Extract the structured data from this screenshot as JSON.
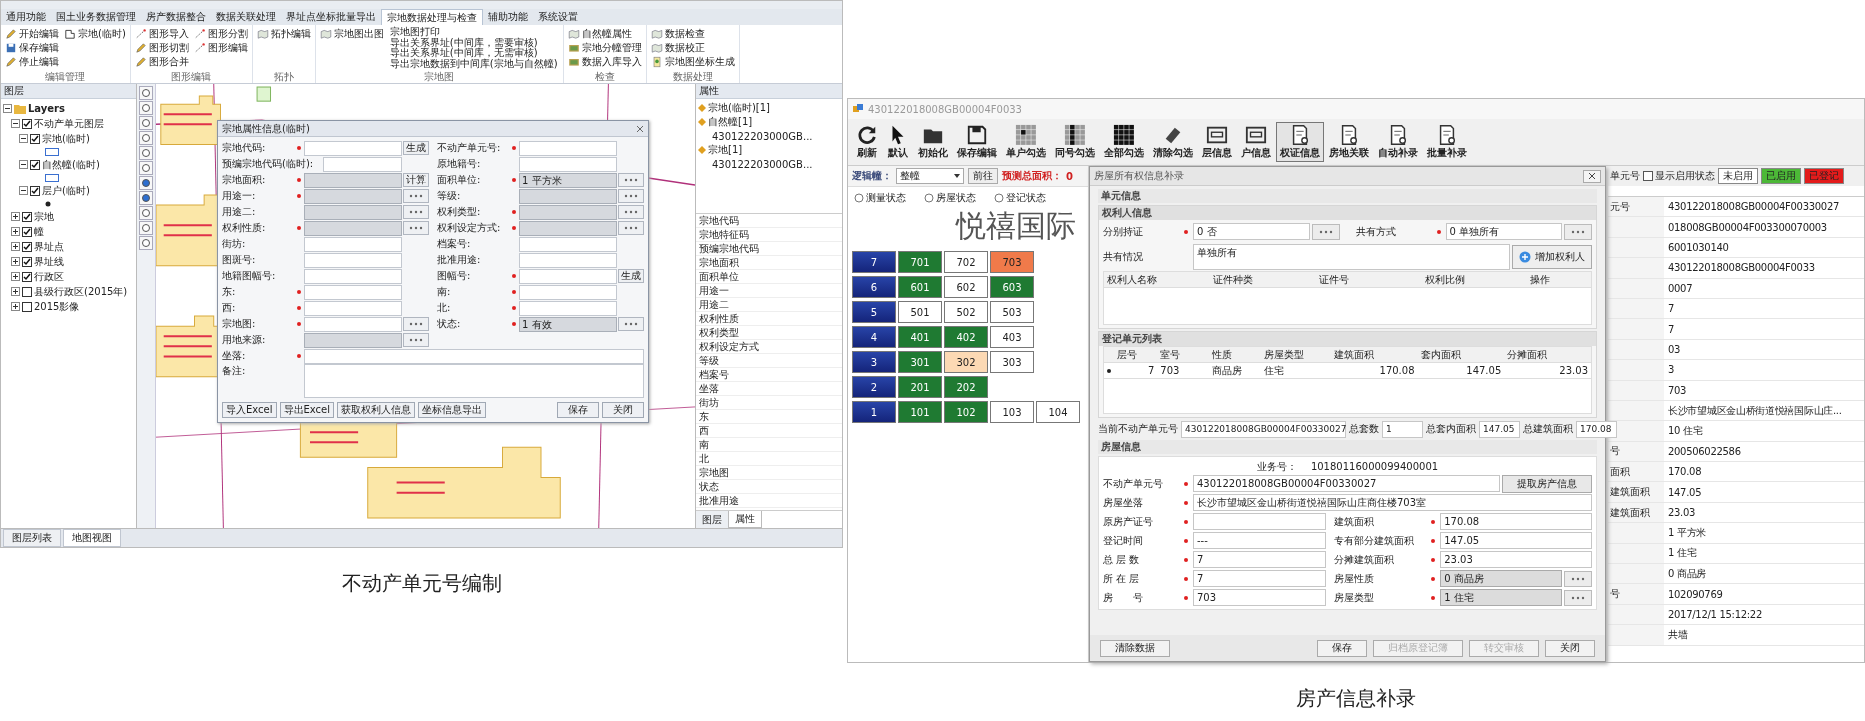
{
  "left_figure": {
    "caption": "不动产单元号编制",
    "ribbon": {
      "tabs": [
        {
          "label": "通用功能",
          "selected": false
        },
        {
          "label": "国土业务数据管理",
          "selected": false
        },
        {
          "label": "房产数据整合",
          "selected": false
        },
        {
          "label": "数据关联处理",
          "selected": false
        },
        {
          "label": "界址点坐标批量导出",
          "selected": false
        },
        {
          "label": "宗地数据处理与检查",
          "selected": true
        },
        {
          "label": "辅助功能",
          "selected": false
        },
        {
          "label": "系统设置",
          "selected": false
        }
      ],
      "groups": [
        {
          "name": "编辑管理",
          "items": [
            "开始编辑",
            "保存编辑",
            "停止编辑",
            "宗地(临时)"
          ]
        },
        {
          "name": "图形编辑",
          "items": [
            "图形导入",
            "图形切割",
            "图形合并",
            "图形分割",
            "图形编辑"
          ]
        },
        {
          "name": "拓扑",
          "items": [
            "拓扑编辑"
          ]
        },
        {
          "name": "宗地图",
          "items": [
            "宗地图出图"
          ],
          "links": [
            "宗地图打印",
            "导出关系界址(中间库，需要审核)",
            "导出关系界址(中间库，无需审核)",
            "导出宗地数据到中间库(宗地与自然幢)"
          ]
        },
        {
          "name": "检查",
          "items": [
            "自然幢属性",
            "宗地分幢管理",
            "数据入库导入"
          ]
        },
        {
          "name": "数据处理",
          "items": [
            "数据检查",
            "数据校正",
            "宗地图坐标生成"
          ]
        }
      ]
    },
    "layer_panel": {
      "title": "图层",
      "tree": [
        {
          "label": "Layers",
          "expanded": true,
          "children": [
            {
              "label": "不动产单元图层",
              "checked": true,
              "expanded": true,
              "children": [
                {
                  "label": "宗地(临时)",
                  "checked": true,
                  "expanded": true,
                  "kind": "polygon"
                },
                {
                  "label": "自然幢(临时)",
                  "checked": true,
                  "expanded": true,
                  "kind": "polygon"
                },
                {
                  "label": "层户(临时)",
                  "checked": true,
                  "expanded": true,
                  "kind": "point"
                }
              ]
            },
            {
              "label": "宗地",
              "checked": true,
              "expanded": false
            },
            {
              "label": "幢",
              "checked": true,
              "expanded": false
            },
            {
              "label": "界址点",
              "checked": true,
              "expanded": false
            },
            {
              "label": "界址线",
              "checked": true,
              "expanded": false
            },
            {
              "label": "行政区",
              "checked": true,
              "expanded": false
            },
            {
              "label": "县级行政区(2015年)",
              "checked": false,
              "expanded": false
            },
            {
              "label": "2015影像",
              "checked": false,
              "expanded": false
            }
          ]
        }
      ]
    },
    "dialog": {
      "title": "宗地属性信息(临时)",
      "left_fields": [
        {
          "label": "宗地代码:",
          "required": true,
          "disabled": false,
          "action": "生成"
        },
        {
          "label": "预编宗地代码(临时):",
          "required": false,
          "disabled": false
        },
        {
          "label": "宗地面积:",
          "required": true,
          "disabled": true,
          "action": "计算"
        },
        {
          "label": "用途一:",
          "required": true,
          "disabled": true,
          "picker": true
        },
        {
          "label": "用途二:",
          "required": false,
          "disabled": true,
          "picker": true
        },
        {
          "label": "权利性质:",
          "required": true,
          "disabled": true,
          "picker": true
        },
        {
          "label": "街坊:",
          "required": false,
          "disabled": false
        },
        {
          "label": "图斑号:",
          "required": false,
          "disabled": false
        },
        {
          "label": "地籍图幅号:",
          "required": false,
          "disabled": false
        },
        {
          "label": "东:",
          "required": true,
          "disabled": false
        },
        {
          "label": "西:",
          "required": true,
          "disabled": false
        },
        {
          "label": "宗地图:",
          "required": true,
          "disabled": false,
          "picker": true
        },
        {
          "label": "用地来源:",
          "required": false,
          "disabled": true,
          "picker": true
        }
      ],
      "right_fields": [
        {
          "label": "不动产单元号:",
          "required": true,
          "disabled": false
        },
        {
          "label": "原地籍号:",
          "required": false,
          "disabled": false
        },
        {
          "label": "面积单位:",
          "required": true,
          "disabled": true,
          "value": "1 平方米",
          "picker": true
        },
        {
          "label": "等级:",
          "required": false,
          "disabled": true,
          "picker": true
        },
        {
          "label": "权利类型:",
          "required": true,
          "disabled": true,
          "picker": true
        },
        {
          "label": "权利设定方式:",
          "required": true,
          "disabled": true,
          "picker": true
        },
        {
          "label": "档案号:",
          "required": false,
          "disabled": false
        },
        {
          "label": "批准用途:",
          "required": false,
          "disabled": false
        },
        {
          "label": "图幅号:",
          "required": true,
          "disabled": false,
          "action": "生成"
        },
        {
          "label": "南:",
          "required": true,
          "disabled": false
        },
        {
          "label": "北:",
          "required": true,
          "disabled": false
        },
        {
          "label": "状态:",
          "required": true,
          "disabled": true,
          "value": "1 有效",
          "picker": true
        }
      ],
      "address": {
        "label": "坐落:",
        "required": true
      },
      "remarks": {
        "label": "备注:"
      },
      "left_buttons": [
        "导入Excel",
        "导出Excel",
        "获取权利人信息",
        "坐标信息导出"
      ],
      "right_buttons": [
        "保存",
        "关闭"
      ]
    },
    "attribute_panel": {
      "title": "属性",
      "tree": [
        {
          "label": "宗地(临时)[1]"
        },
        {
          "label": "自然幢[1]",
          "children": [
            "430122203000GB..."
          ]
        },
        {
          "label": "宗地[1]",
          "children": [
            "430122203000GB..."
          ]
        }
      ],
      "properties": [
        "宗地代码",
        "宗地特征码",
        "预编宗地代码",
        "宗地面积",
        "面积单位",
        "用途一",
        "用途二",
        "权利性质",
        "权利类型",
        "权利设定方式",
        "等级",
        "档案号",
        "坐落",
        "街坊",
        "东",
        "西",
        "南",
        "北",
        "宗地图",
        "状态",
        "批准用途"
      ],
      "tabs": [
        {
          "label": "图层",
          "selected": false
        },
        {
          "label": "属性",
          "selected": true
        }
      ]
    },
    "bottom_tabs": [
      {
        "label": "图层列表",
        "selected": false
      },
      {
        "label": "地图视图",
        "selected": true
      }
    ]
  },
  "right_figure": {
    "caption": "房产信息补录",
    "title": "430122018008GB00004F0033",
    "toolbar": [
      {
        "label": "刷新",
        "selected": false
      },
      {
        "label": "默认",
        "selected": false
      },
      {
        "label": "初始化",
        "selected": false
      },
      {
        "label": "保存编辑",
        "selected": false
      },
      {
        "label": "单户勾选",
        "selected": false
      },
      {
        "label": "同号勾选",
        "selected": false
      },
      {
        "label": "全部勾选",
        "selected": false
      },
      {
        "label": "清除勾选",
        "selected": false
      },
      {
        "label": "层信息",
        "selected": false
      },
      {
        "label": "户信息",
        "selected": false
      },
      {
        "label": "权证信息",
        "selected": true
      },
      {
        "label": "房地关联",
        "selected": false
      },
      {
        "label": "自动补录",
        "selected": false
      },
      {
        "label": "批量补录",
        "selected": false
      }
    ],
    "building": {
      "selector_label": "逻辑幢：",
      "selector_value": "整幢",
      "go_button": "前往",
      "area_label": "预测总面积：",
      "area_value": "0",
      "modes": [
        {
          "label": "测量状态",
          "selected": false
        },
        {
          "label": "房屋状态",
          "selected": false
        },
        {
          "label": "登记状态",
          "selected": false
        }
      ],
      "name": "悦禧国际",
      "floors": [
        {
          "floor": "7",
          "units": [
            {
              "label": "701",
              "color": "#1f7a32"
            },
            {
              "label": "702",
              "color": "#ffffff"
            },
            {
              "label": "703",
              "color": "#f07a4a"
            }
          ]
        },
        {
          "floor": "6",
          "units": [
            {
              "label": "601",
              "color": "#1f7a32"
            },
            {
              "label": "602",
              "color": "#ffffff"
            },
            {
              "label": "603",
              "color": "#1f7a32"
            }
          ]
        },
        {
          "floor": "5",
          "units": [
            {
              "label": "501",
              "color": "#ffffff"
            },
            {
              "label": "502",
              "color": "#ffffff"
            },
            {
              "label": "503",
              "color": "#ffffff"
            }
          ]
        },
        {
          "floor": "4",
          "units": [
            {
              "label": "401",
              "color": "#1f7a32"
            },
            {
              "label": "402",
              "color": "#1f7a32"
            },
            {
              "label": "403",
              "color": "#ffffff"
            }
          ]
        },
        {
          "floor": "3",
          "units": [
            {
              "label": "301",
              "color": "#1f7a32"
            },
            {
              "label": "302",
              "color": "#fcd9b4"
            },
            {
              "label": "303",
              "color": "#ffffff"
            }
          ]
        },
        {
          "floor": "2",
          "units": [
            {
              "label": "201",
              "color": "#1f7a32"
            },
            {
              "label": "202",
              "color": "#1f7a32"
            }
          ]
        },
        {
          "floor": "1",
          "units": [
            {
              "label": "101",
              "color": "#1f7a32"
            },
            {
              "label": "102",
              "color": "#1f7a32"
            },
            {
              "label": "103",
              "color": "#ffffff"
            },
            {
              "label": "104",
              "color": "#ffffff"
            }
          ]
        }
      ]
    },
    "dialog": {
      "title": "房屋所有权信息补录",
      "unit_section": "单元信息",
      "owner_section": "权利人信息",
      "owner_fields": [
        {
          "label": "分别持证",
          "required": true,
          "value": "0 否",
          "picker": true
        },
        {
          "label": "共有方式",
          "required": true,
          "value": "0 单独所有",
          "picker": true
        }
      ],
      "share_label": "共有情况",
      "share_value": "单独所有",
      "add_owner_button": "增加权利人",
      "owner_columns": [
        "权利人名称",
        "证件种类",
        "证件号",
        "权利比例",
        "操作"
      ],
      "units_section": "登记单元列表",
      "unit_columns": [
        "层号",
        "室号",
        "性质",
        "房屋类型",
        "建筑面积",
        "套内面积",
        "分摊面积"
      ],
      "unit_rows": [
        [
          "7",
          "703",
          "商品房",
          "住宅",
          "170.08",
          "147.05",
          "23.03"
        ]
      ],
      "summary": [
        {
          "label": "当前不动产单元号",
          "value": "430122018008GB00004F00330027"
        },
        {
          "label": "总套数",
          "value": "1"
        },
        {
          "label": "总套内面积",
          "value": "147.05"
        },
        {
          "label": "总建筑面积",
          "value": "170.08"
        }
      ],
      "house_section": "房屋信息",
      "business_label": "业务号：",
      "business_value": "10180116000099400001",
      "unit_no": {
        "label": "不动产单元号",
        "required": true,
        "value": "430122018008GB00004F00330027"
      },
      "fetch_button": "提取房产信息",
      "location": {
        "label": "房屋坐落",
        "required": true,
        "value": "长沙市望城区金山桥街道悦禧国际山庄商住楼703室"
      },
      "left_fields": [
        {
          "label": "原房产证号",
          "required": true,
          "disabled": false
        },
        {
          "label": "登记时间",
          "required": true,
          "disabled": false,
          "value": "---"
        },
        {
          "label": "总 层 数",
          "required": true,
          "disabled": false,
          "value": "7"
        },
        {
          "label": "所 在 层",
          "required": true,
          "disabled": false,
          "value": "7"
        },
        {
          "label": "房　　号",
          "required": true,
          "disabled": false,
          "value": "703"
        }
      ],
      "right_fields": [
        {
          "label": "建筑面积",
          "required": true,
          "disabled": false,
          "value": "170.08"
        },
        {
          "label": "专有部分建筑面积",
          "required": true,
          "disabled": false,
          "value": "147.05"
        },
        {
          "label": "分摊建筑面积",
          "required": true,
          "disabled": false,
          "value": "23.03"
        },
        {
          "label": "房屋性质",
          "required": true,
          "disabled": true,
          "value": "0 商品房",
          "picker": true
        },
        {
          "label": "房屋类型",
          "required": true,
          "disabled": true,
          "value": "1 住宅",
          "picker": true
        }
      ],
      "buttons": [
        {
          "label": "清除数据",
          "disabled": false
        },
        {
          "label": "保存",
          "disabled": false
        },
        {
          "label": "归档原登记簿",
          "disabled": true
        },
        {
          "label": "转交审核",
          "disabled": true
        },
        {
          "label": "关闭",
          "disabled": false
        }
      ]
    },
    "side": {
      "partial_label": "单元号",
      "checkbox": {
        "label": "显示启用状态",
        "checked": false
      },
      "legend": [
        {
          "label": "未启用",
          "color": "#ffffff"
        },
        {
          "label": "已启用",
          "color": "#4cb837"
        },
        {
          "label": "已登记",
          "color": "#e31b1b"
        }
      ],
      "rows": [
        {
          "label": "元号",
          "value": "430122018008GB00004F00330027"
        },
        {
          "value": "018008GB00004F003300070003"
        },
        {
          "value": "6001030140"
        },
        {
          "value": "430122018008GB00004F0033"
        },
        {
          "value": "0007"
        },
        {
          "value": "7"
        },
        {
          "value": "7"
        },
        {
          "value": "03"
        },
        {
          "value": "3"
        },
        {
          "value": "703"
        },
        {
          "value": "长沙市望城区金山桥街道悦禧国际山庄..."
        },
        {
          "value": "10 住宅"
        },
        {
          "label": "号",
          "value": "200506022586"
        },
        {
          "label": "面积",
          "value": "170.08"
        },
        {
          "label": "建筑面积",
          "value": "147.05"
        },
        {
          "label": "建筑面积",
          "value": "23.03"
        },
        {
          "value": "1 平方米"
        },
        {
          "value": "1 住宅"
        },
        {
          "value": "0 商品房"
        },
        {
          "label": "号",
          "value": "102090769"
        },
        {
          "value": "2017/12/1 15:12:22"
        },
        {
          "value": "共墙"
        }
      ]
    }
  }
}
